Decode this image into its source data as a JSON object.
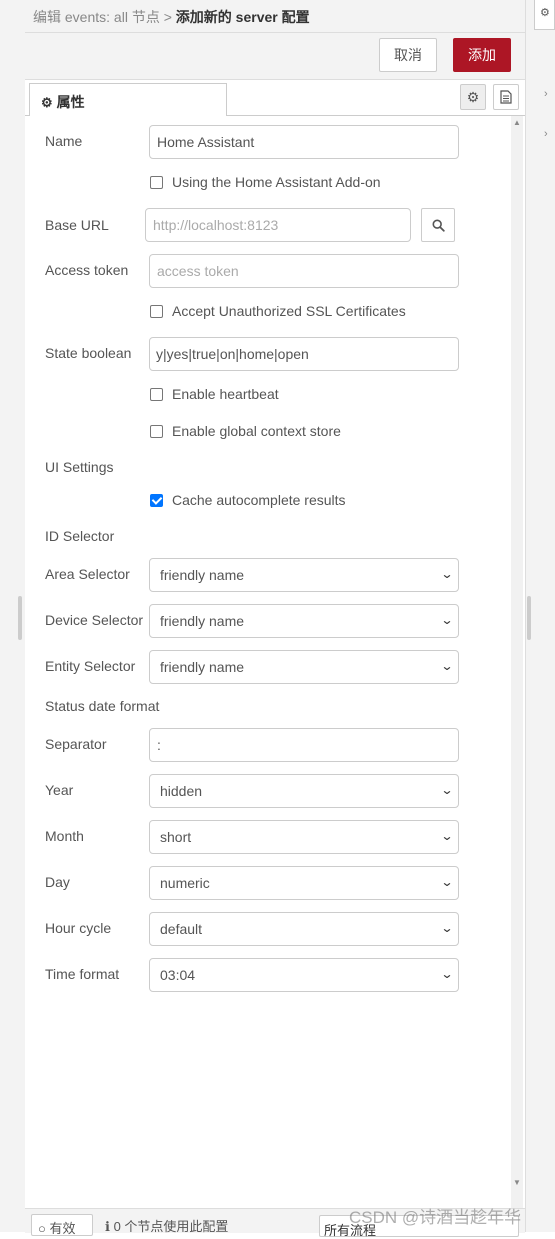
{
  "header": {
    "breadcrumb_prefix": "编辑 events: all 节点 >",
    "breadcrumb_current": "添加新的 server 配置"
  },
  "buttons": {
    "cancel": "取消",
    "add": "添加"
  },
  "tab": {
    "label": "属性"
  },
  "form": {
    "name": {
      "label": "Name",
      "value": "Home Assistant"
    },
    "addon": {
      "label": "Using the Home Assistant Add-on",
      "checked": false
    },
    "base_url": {
      "label": "Base URL",
      "placeholder": "http://localhost:8123"
    },
    "access_token": {
      "label": "Access token",
      "placeholder": "access token"
    },
    "ssl": {
      "label": "Accept Unauthorized SSL Certificates",
      "checked": false
    },
    "state_boolean": {
      "label": "State boolean",
      "value": "y|yes|true|on|home|open"
    },
    "heartbeat": {
      "label": "Enable heartbeat",
      "checked": false
    },
    "global_context": {
      "label": "Enable global context store",
      "checked": false
    },
    "ui_settings": {
      "label": "UI Settings"
    },
    "cache": {
      "label": "Cache autocomplete results",
      "checked": true
    },
    "id_selector": {
      "label": "ID Selector"
    },
    "area_selector": {
      "label": "Area Selector",
      "value": "friendly name"
    },
    "device_selector": {
      "label": "Device Selector",
      "value": "friendly name"
    },
    "entity_selector": {
      "label": "Entity Selector",
      "value": "friendly name"
    },
    "status_date_format": {
      "label": "Status date format"
    },
    "separator": {
      "label": "Separator",
      "value": ":"
    },
    "year": {
      "label": "Year",
      "value": "hidden"
    },
    "month": {
      "label": "Month",
      "value": "short"
    },
    "day": {
      "label": "Day",
      "value": "numeric"
    },
    "hour_cycle": {
      "label": "Hour cycle",
      "value": "default"
    },
    "time_format": {
      "label": "Time format",
      "value": "03:04"
    }
  },
  "footer": {
    "valid_label": "有效",
    "nodes_info": "0 个节点使用此配置",
    "flow_select": "所有流程"
  },
  "watermark": "CSDN @诗酒当趁年华",
  "colors": {
    "accent": "#ad1625",
    "checkbox": "#0075ff"
  }
}
